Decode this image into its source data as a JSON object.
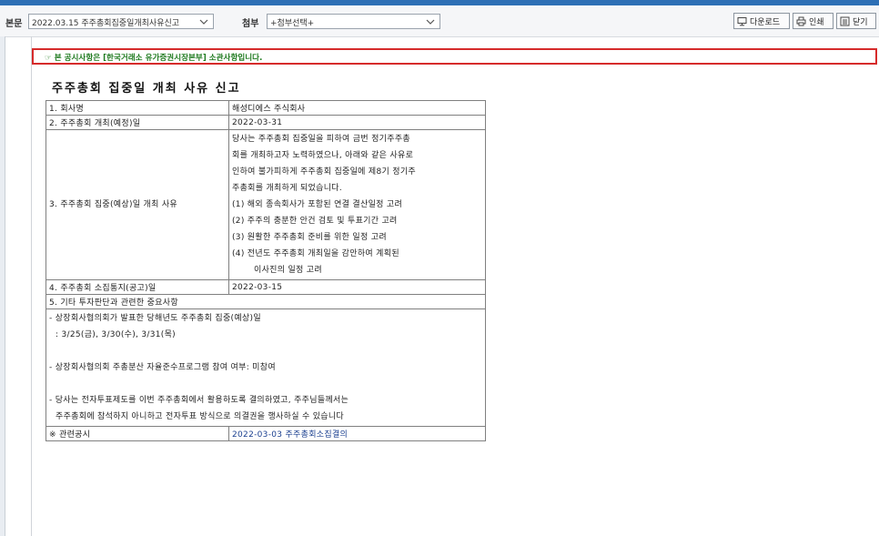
{
  "toolbar": {
    "body_label": "본문",
    "body_select": "2022.03.15  주주총회집중일개최사유신고",
    "attach_label": "첨부",
    "attach_select": "+첨부선택+",
    "download_label": "다운로드",
    "print_label": "인쇄",
    "close_label": "닫기"
  },
  "notice": "☞ 본 공시사항은 [한국거래소 유가증권시장본부] 소관사항입니다.",
  "doc_title": "주주총회 집중일 개최 사유 신고",
  "rows": {
    "company": {
      "label": "1. 회사명",
      "value": "해성디에스 주식회사"
    },
    "date": {
      "label": "2. 주주총회 개최(예정)일",
      "value": "2022-03-31"
    },
    "reason": {
      "label": "3. 주주총회 집중(예상)일 개최 사유",
      "lines": [
        "당사는 주주총회 집중일을 피하여 금번 정기주주총",
        "회를 개최하고자 노력하였으나, 아래와 같은 사유로",
        "인하여 불가피하게 주주총회 집중일에 제8기 정기주",
        "주총회를 개최하게 되었습니다.",
        "(1) 해외 종속회사가 포함된 연결 결산일정 고려",
        "(2) 주주의 충분한 안건 검토 및 투표기간 고려",
        "(3) 원활한 주주총회 준비를 위한 일정 고려",
        "(4) 전년도 주주총회 개최일을 감안하여 계획된",
        "이사진의 일정 고려"
      ]
    },
    "notice_date": {
      "label": "4. 주주총회 소집통지(공고)일",
      "value": "2022-03-15"
    },
    "other": {
      "label": "5. 기타 투자판단과 관련한 중요사항",
      "lines": [
        "- 상장회사협의회가 발표한 당해년도 주주총회 집중(예상)일",
        ": 3/25(금), 3/30(수), 3/31(목)",
        "",
        "- 상장회사협의회 주총분산 자율준수프로그램 참여 여부: 미참여",
        "",
        "- 당사는 전자투표제도를 이번 주주총회에서 활용하도록 결의하였고, 주주님들께서는",
        "주주총회에 참석하지 아니하고 전자투표 방식으로 의결권을 행사하실 수 있습니다"
      ]
    },
    "related": {
      "label": "※ 관련공시",
      "value": "2022-03-03 주주총회소집결의"
    }
  }
}
